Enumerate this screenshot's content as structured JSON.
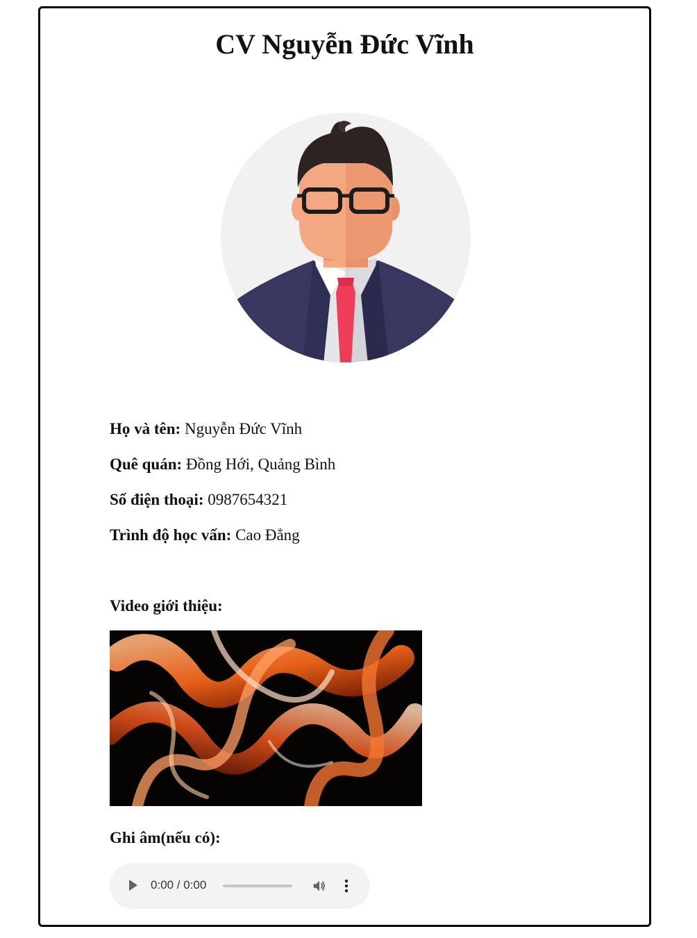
{
  "page": {
    "title": "CV Nguyễn Đức Vĩnh"
  },
  "profile": {
    "avatar_icon": "avatar-man-suit-glasses-icon",
    "rows": [
      {
        "label": "Họ và tên:",
        "value": " Nguyễn Đức Vĩnh"
      },
      {
        "label": "Quê quán:",
        "value": " Đồng Hới, Quảng Bình"
      },
      {
        "label": "Số điện thoại:",
        "value": " 0987654321"
      },
      {
        "label": "Trình độ học vấn:",
        "value": " Cao Đẳng"
      }
    ]
  },
  "video": {
    "label": "Video giới thiệu:"
  },
  "audio": {
    "label": "Ghi âm(nếu có):",
    "time": "0:00 / 0:00",
    "progress": 0,
    "icons": [
      "play-icon",
      "volume-icon",
      "more-options-icon"
    ]
  },
  "colors": {
    "suit": "#37375f",
    "tie": "#ee3d5b",
    "skin": "#f4a882",
    "hair": "#2d2422",
    "avatar_bg": "#f1f1f1",
    "player_bg": "#f1f3f4"
  }
}
